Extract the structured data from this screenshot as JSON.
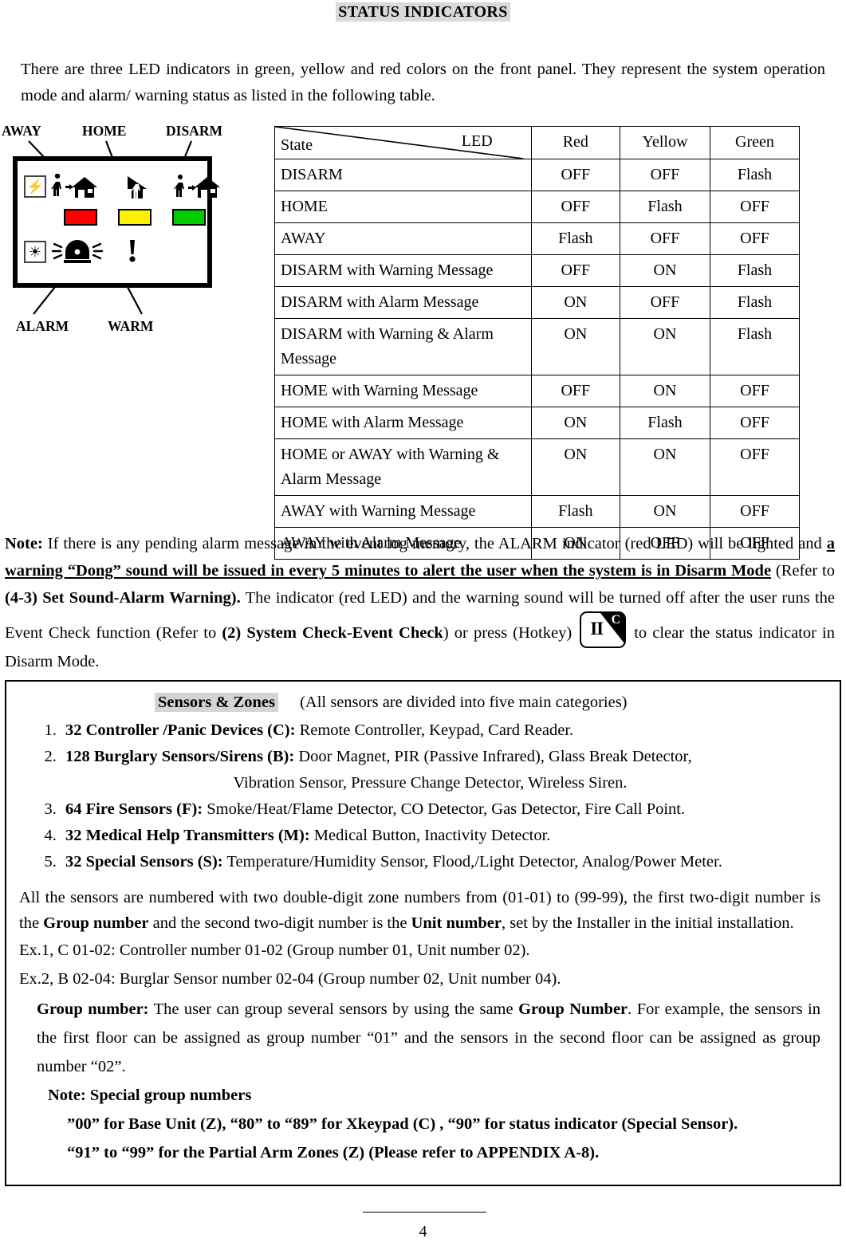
{
  "page": {
    "title": "STATUS INDICATORS",
    "page_number": "4",
    "intro": "There are three LED indicators in green, yellow and red colors on the front panel. They represent the system operation mode and alarm/ warning status as listed in the following table."
  },
  "diagram": {
    "labels": {
      "away": "AWAY",
      "home": "HOME",
      "disarm": "DISARM",
      "alarm": "ALARM",
      "warm": "WARM"
    },
    "leds": {
      "red": "#FF0000",
      "yellow": "#FFF000",
      "green": "#00CC00"
    },
    "icons": {
      "power": "⚡",
      "sun": "☀"
    }
  },
  "status_table": {
    "header": {
      "state": "State",
      "led": "LED",
      "red": "Red",
      "yellow": "Yellow",
      "green": "Green"
    },
    "rows": [
      {
        "state": "DISARM",
        "red": "OFF",
        "yellow": "OFF",
        "green": "Flash"
      },
      {
        "state": "HOME",
        "red": "OFF",
        "yellow": "Flash",
        "green": "OFF"
      },
      {
        "state": "AWAY",
        "red": "Flash",
        "yellow": "OFF",
        "green": "OFF"
      },
      {
        "state": "DISARM with Warning Message",
        "red": "OFF",
        "yellow": "ON",
        "green": "Flash"
      },
      {
        "state": "DISARM with Alarm Message",
        "red": "ON",
        "yellow": "OFF",
        "green": "Flash"
      },
      {
        "state": "DISARM with Warning & Alarm Message",
        "red": "ON",
        "yellow": "ON",
        "green": "Flash"
      },
      {
        "state": "HOME with Warning Message",
        "red": "OFF",
        "yellow": "ON",
        "green": "OFF"
      },
      {
        "state": "HOME with Alarm Message",
        "red": "ON",
        "yellow": "Flash",
        "green": "OFF"
      },
      {
        "state": "HOME or AWAY with Warning & Alarm Message",
        "red": "ON",
        "yellow": "ON",
        "green": "OFF"
      },
      {
        "state": "AWAY with Warning Message",
        "red": "Flash",
        "yellow": "ON",
        "green": "OFF"
      },
      {
        "state": "AWAY with Alarm Message",
        "red": "ON",
        "yellow": "OFF",
        "green": "OFF"
      }
    ]
  },
  "note": {
    "label": "Note:",
    "p1_a": "If there is any pending alarm message in the event log memory, the ALARM indicator (red LED) will be lighted and ",
    "p1_bold_underline": "a warning “Dong” sound will be issued in every 5 minutes to alert the user when the system is in Disarm Mode",
    "p1_b": " (Refer to ",
    "p1_bold2": "(4-3) Set Sound-Alarm Warning).",
    "p1_c": " The indicator (red LED) and the warning sound will be turned off after the user runs the Event Check function (Refer to ",
    "p1_bold3": "(2) System Check-Event Check",
    "p1_d": ") or press (Hotkey)",
    "p1_e": "to clear the status indicator in Disarm Mode.",
    "hotkey_pause": "II",
    "hotkey_letter": "C"
  },
  "sensors": {
    "title": "Sensors & Zones",
    "subtitle": "(All sensors are divided into five main categories)",
    "items": [
      {
        "bold": "32 Controller /Panic Devices (C):",
        "text": " Remote Controller, Keypad, Card Reader.",
        "continuation": ""
      },
      {
        "bold": "128 Burglary Sensors/Sirens (B):",
        "text": " Door Magnet, PIR (Passive Infrared), Glass Break Detector,",
        "continuation": "Vibration Sensor, Pressure Change Detector, Wireless Siren."
      },
      {
        "bold": "64 Fire Sensors (F):",
        "text": " Smoke/Heat/Flame Detector, CO Detector, Gas Detector, Fire Call Point.",
        "continuation": ""
      },
      {
        "bold": "32 Medical Help Transmitters (M):",
        "text": " Medical Button, Inactivity Detector.",
        "continuation": ""
      },
      {
        "bold": "32 Special Sensors (S):",
        "text": " Temperature/Humidity Sensor, Flood,/Light Detector, Analog/Power Meter.",
        "continuation": ""
      }
    ],
    "zone_para_a": "All the sensors are numbered with two double-digit zone numbers from (01-01) to (99-99), the first two-digit number is the ",
    "zone_bold_group": "Group number",
    "zone_para_b": " and the second two-digit number is the ",
    "zone_bold_unit": "Unit number",
    "zone_para_c": ", set by the Installer in the initial installation.",
    "example_1": "Ex.1, C 01-02: Controller number 01-02 (Group number 01, Unit number 02).",
    "example_2": "Ex.2, B 02-04: Burglar Sensor number 02-04 (Group number 02, Unit number 04).",
    "group_label": "Group number:",
    "group_text_a": " The user can group several sensors by using the same ",
    "group_bold": "Group Number",
    "group_text_b": ". For example, the sensors in the first floor can be assigned as group number “01” and the sensors in the second floor can be assigned as group number “02”.",
    "special_note_title": "Note: Special group numbers",
    "special_line_1": "”00” for Base Unit (Z), “80” to “89” for Xkeypad (C) , “90” for status indicator (Special Sensor).",
    "special_line_2": "“91” to “99” for the Partial Arm Zones (Z) (Please refer to APPENDIX A-8)."
  }
}
